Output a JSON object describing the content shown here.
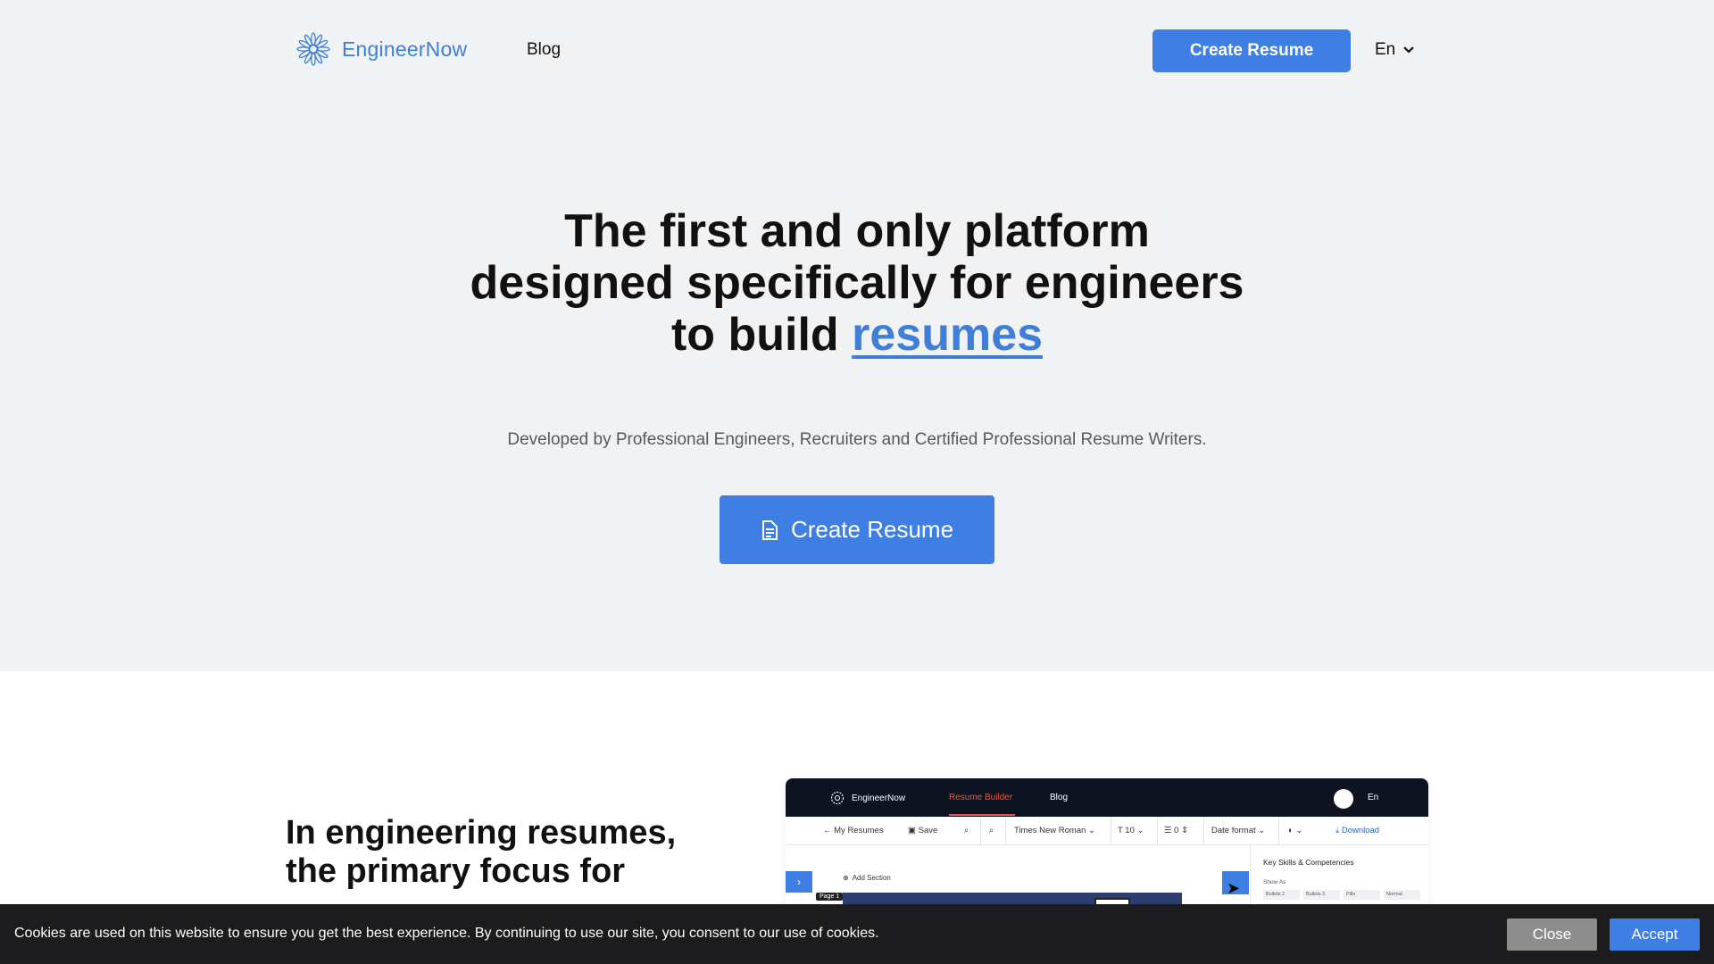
{
  "header": {
    "logo_text": "EngineerNow",
    "nav_blog": "Blog",
    "create_resume_label": "Create Resume",
    "language": "En"
  },
  "hero": {
    "headline_line1": "The first and only platform",
    "headline_line2": "designed specifically for engineers",
    "headline_line3_prefix": "to build ",
    "headline_accent": "resumes",
    "subtitle": "Developed by Professional Engineers, Recruiters and Certified Professional Resume Writers.",
    "cta_label": "Create Resume"
  },
  "section": {
    "title_line1": "In engineering resumes,",
    "title_line2": "the primary focus for"
  },
  "app_preview": {
    "logo_text": "EngineerNow",
    "nav_resume_builder": "Resume Builder",
    "nav_blog": "Blog",
    "language": "En",
    "toolbar": {
      "my_resumes": "My Resumes",
      "save": "Save",
      "font": "Times New Roman",
      "font_size": "10",
      "spacing": "0",
      "date_format": "Date format",
      "download": "Download"
    },
    "add_section": "Add Section",
    "page_label": "Page 1",
    "panel_title": "Key Skills & Competencies",
    "show_as": "Show As",
    "options": [
      "Bullets 2",
      "Bullets 3",
      "Pills",
      "Normal"
    ]
  },
  "cookie": {
    "text": "Cookies are used on this website to ensure you get the best experience. By continuing to use our site, you consent to our use of cookies.",
    "close_label": "Close",
    "accept_label": "Accept"
  },
  "colors": {
    "accent": "#3f7fe4",
    "hero_bg": "#f0f2f4",
    "cookie_bg": "#1c1c1e"
  }
}
